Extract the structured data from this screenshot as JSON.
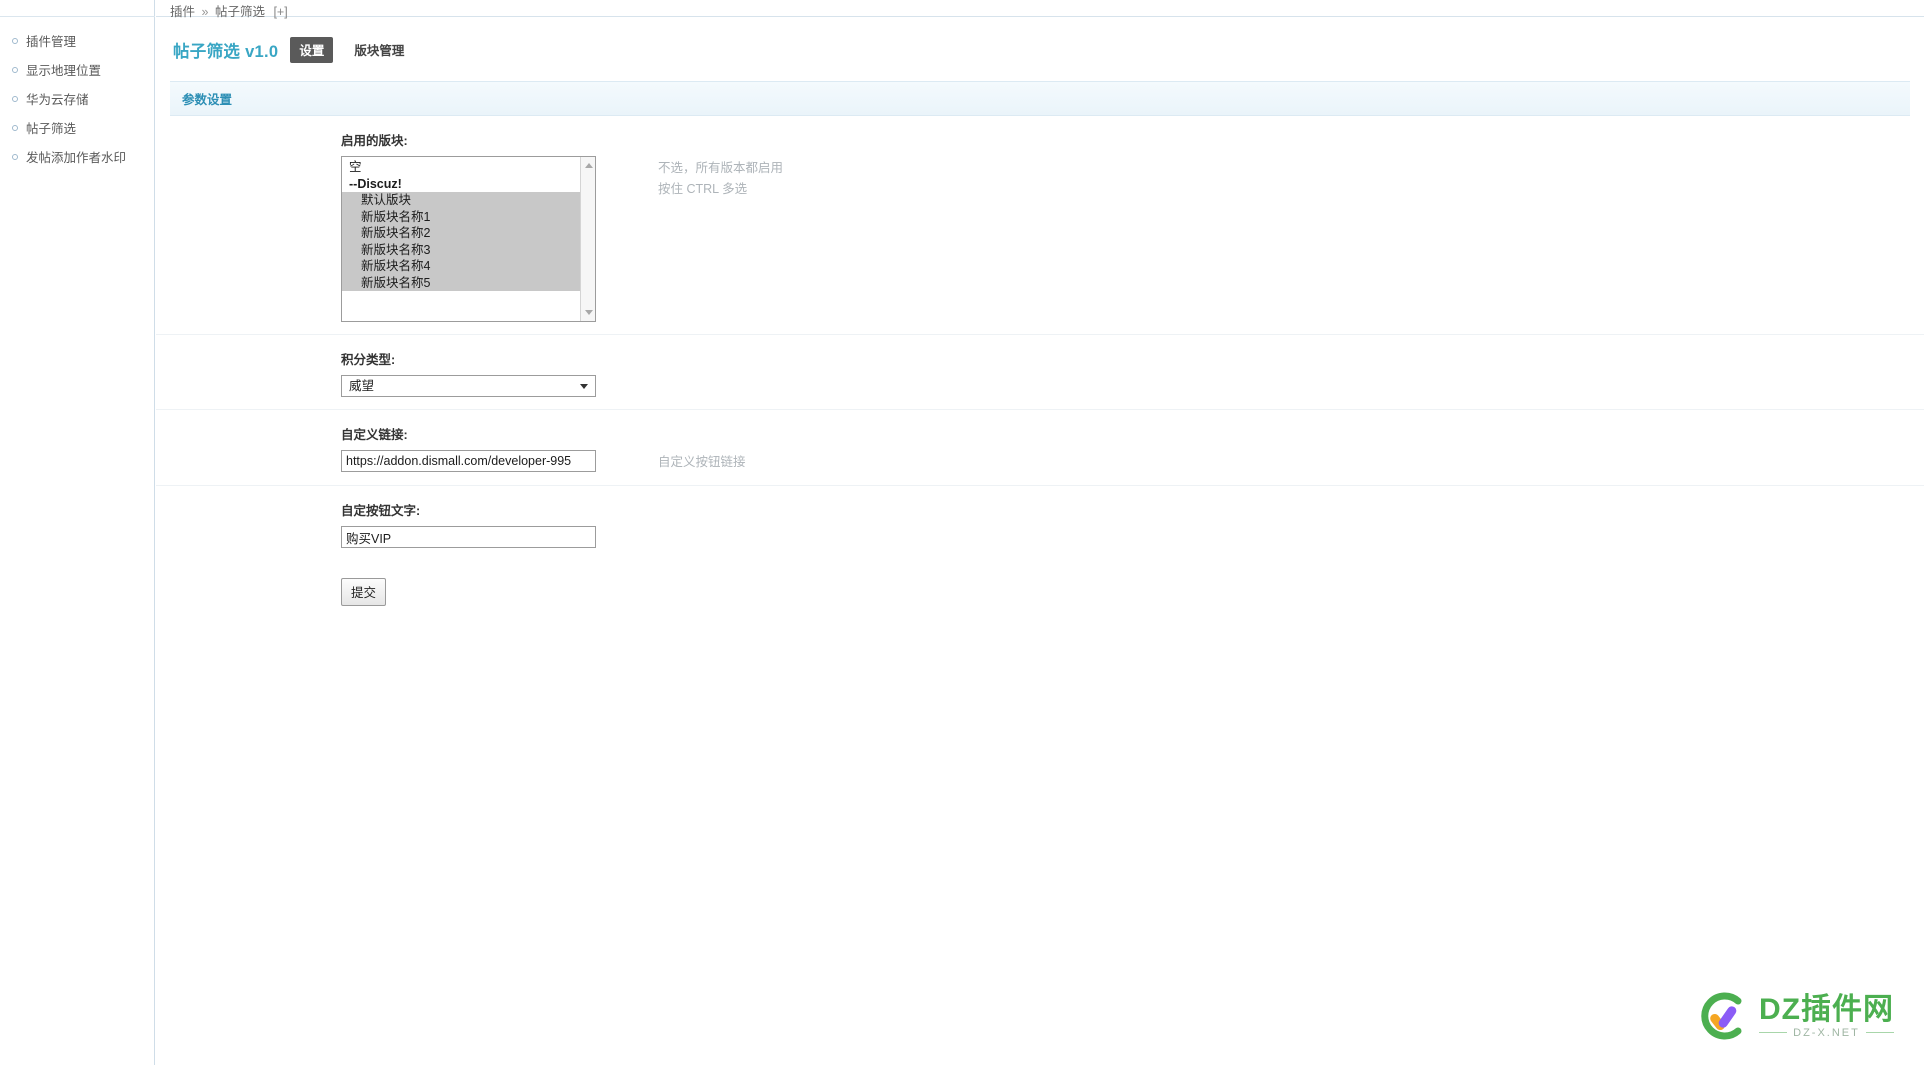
{
  "breadcrumb": {
    "root": "插件",
    "separator": "»",
    "current": "帖子筛选",
    "expand": "[+]"
  },
  "sidebar": {
    "items": [
      {
        "label": "插件管理",
        "icon": "circle-bullet-icon"
      },
      {
        "label": "显示地理位置",
        "icon": "circle-bullet-icon"
      },
      {
        "label": "华为云存储",
        "icon": "circle-bullet-icon"
      },
      {
        "label": "帖子筛选",
        "icon": "circle-bullet-icon"
      },
      {
        "label": "发帖添加作者水印",
        "icon": "circle-bullet-icon"
      }
    ]
  },
  "header": {
    "plugin_title": "帖子筛选 v1.0",
    "tabs": [
      {
        "label": "设置",
        "active": true
      },
      {
        "label": "版块管理",
        "active": false
      }
    ],
    "title_color": "#39a6c4",
    "active_tab_bg": "#5a5a5a"
  },
  "section": {
    "title": "参数设置",
    "title_color": "#2d8fb5"
  },
  "fields": {
    "forums": {
      "label": "启用的版块:",
      "options": [
        {
          "text": "空",
          "selected": false,
          "group": false,
          "indent": false
        },
        {
          "text": "--Discuz!",
          "selected": false,
          "group": true,
          "indent": false
        },
        {
          "text": "默认版块",
          "selected": true,
          "group": false,
          "indent": true
        },
        {
          "text": "新版块名称1",
          "selected": true,
          "group": false,
          "indent": true
        },
        {
          "text": "新版块名称2",
          "selected": true,
          "group": false,
          "indent": true
        },
        {
          "text": "新版块名称3",
          "selected": true,
          "group": false,
          "indent": true
        },
        {
          "text": "新版块名称4",
          "selected": true,
          "group": false,
          "indent": true
        },
        {
          "text": "新版块名称5",
          "selected": true,
          "group": false,
          "indent": true
        }
      ],
      "hint_line1": "不选，所有版本都启用",
      "hint_line2": "按住 CTRL 多选",
      "scroll_up_icon": "triangle-up-icon",
      "scroll_down_icon": "triangle-down-icon"
    },
    "credit_type": {
      "label": "积分类型:",
      "value": "威望",
      "caret_icon": "chevron-down-icon"
    },
    "custom_link": {
      "label": "自定义链接:",
      "value": "https://addon.dismall.com/developer-995",
      "hint": "自定义按钮链接"
    },
    "custom_button_text": {
      "label": "自定按钮文字:",
      "value": "购买VIP"
    }
  },
  "submit": {
    "label": "提交"
  },
  "watermark": {
    "main_text": "DZ插件网",
    "sub_text": "DZ-X.NET",
    "brand_color": "#4caf50"
  }
}
